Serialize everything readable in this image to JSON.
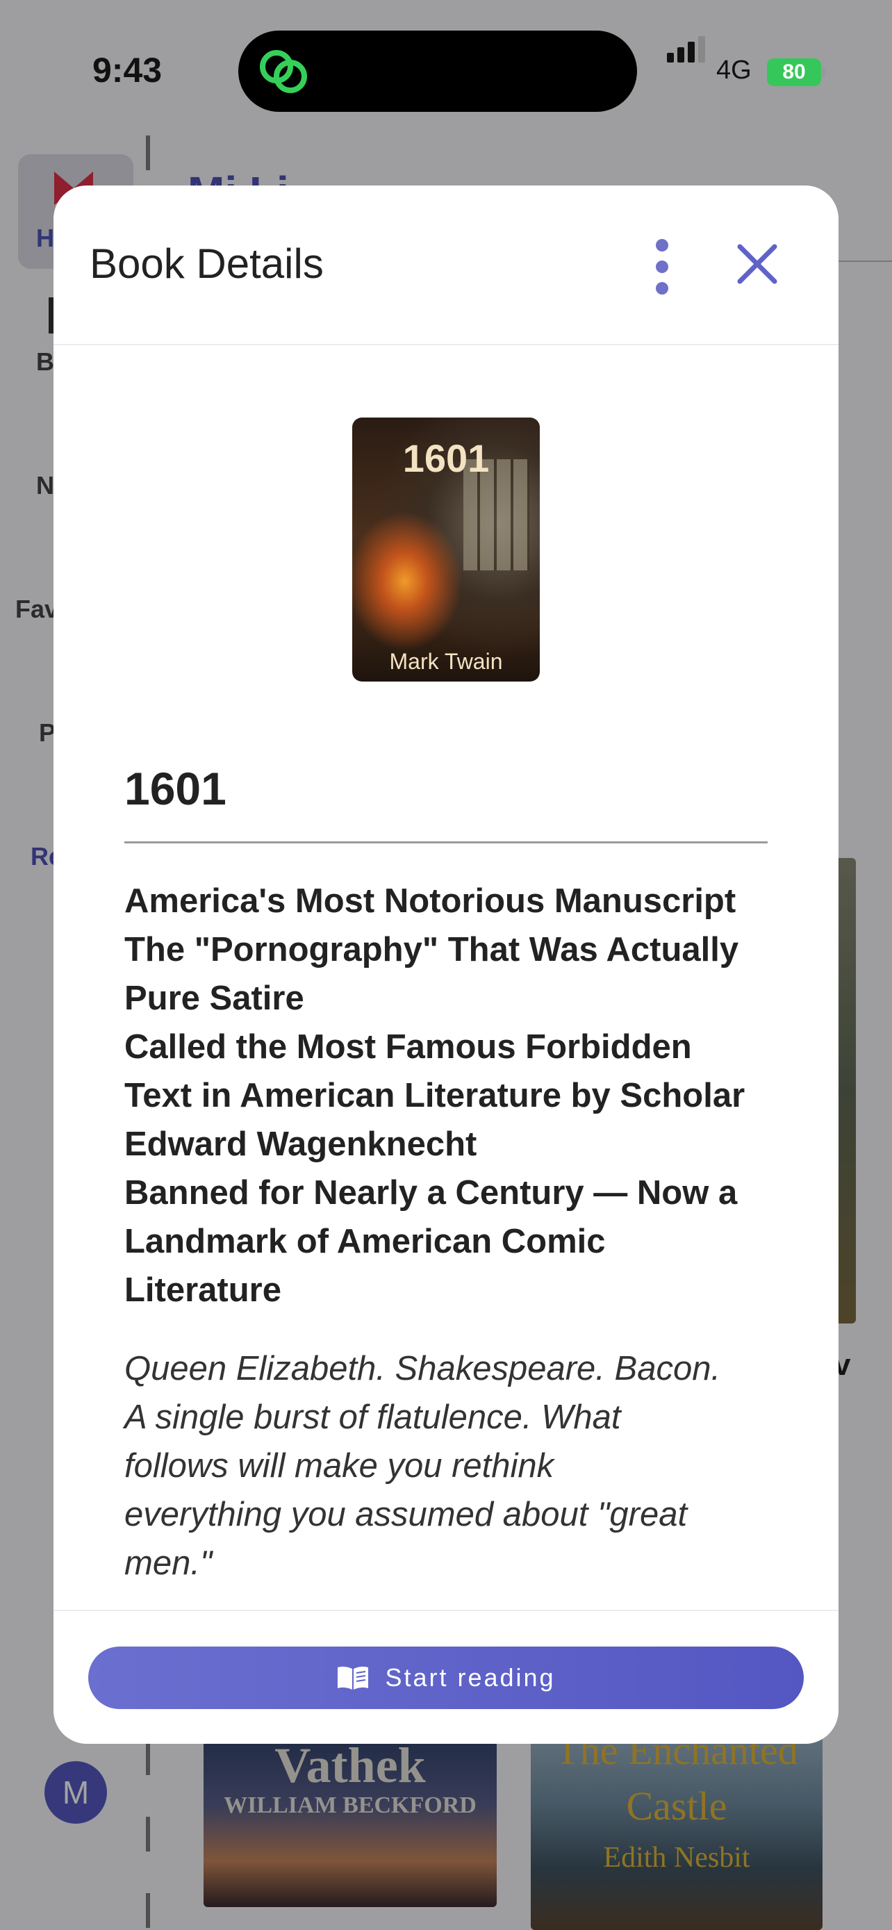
{
  "status_bar": {
    "time": "9:43",
    "network": "4G",
    "battery": "80"
  },
  "background": {
    "heading": "Mi  Li",
    "rail": {
      "home_label": "H",
      "books_label": "B",
      "new_label": "N",
      "favorites_label": "Fav",
      "p_label": "P",
      "recent_label": "Re"
    },
    "avatar_letter": "M",
    "right_letter": "v",
    "covers": [
      {
        "title": "Vathek",
        "author": "WILLIAM BECKFORD"
      },
      {
        "title": "The Enchanted Castle",
        "author": "Edith Nesbit"
      }
    ]
  },
  "modal": {
    "title": "Book Details",
    "cover": {
      "title": "1601",
      "author": "Mark Twain"
    },
    "book_title": "1601",
    "headline_lines": [
      "America's Most Notorious Manuscript",
      "The \"Pornography\" That Was Actually",
      "Pure Satire",
      "Called the Most Famous Forbidden",
      "Text in American Literature by Scholar",
      "Edward Wagenknecht",
      "Banned for Nearly a Century — Now a",
      "Landmark of American Comic",
      "Literature"
    ],
    "blurb_lines": [
      "Queen Elizabeth. Shakespeare. Bacon.",
      "A single burst of flatulence. What",
      "follows will make you rethink",
      "everything you assumed about \"great",
      "men.\""
    ],
    "start_button": "Start reading"
  },
  "colors": {
    "accent": "#5f62c8",
    "battery": "#35c759",
    "island_icon": "#35d05a"
  }
}
